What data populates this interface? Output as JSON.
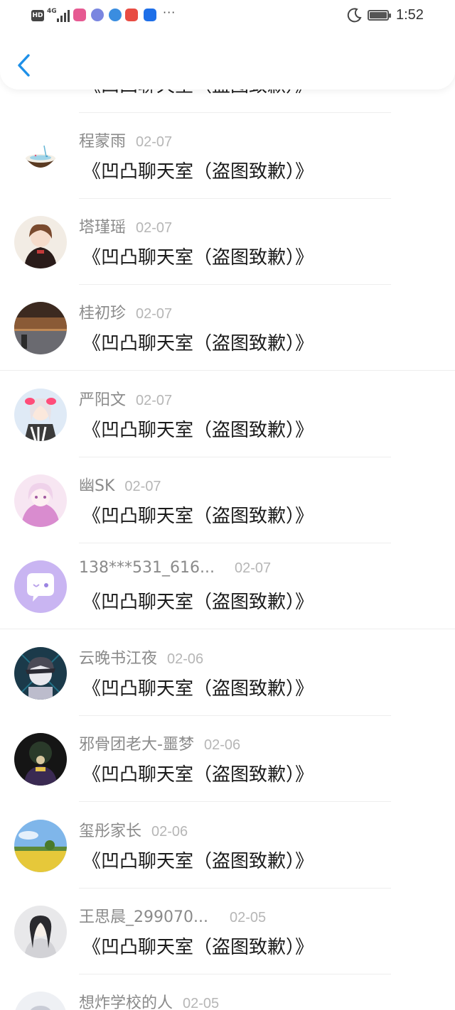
{
  "status_bar": {
    "hd": "HD",
    "network": "4G",
    "time": "1:52",
    "battery_level": 0.85,
    "more": "···"
  },
  "header": {
    "back_icon": "chevron-left-icon",
    "accent": "#1e90e8"
  },
  "partial_top_message": "《凹凸聊天室（盗图致歉）》",
  "comments": [
    {
      "name": "程蒙雨",
      "date": "02-07",
      "message": "《凹凸聊天室（盗图致歉）》"
    },
    {
      "name": "塔瑾瑶",
      "date": "02-07",
      "message": "《凹凸聊天室（盗图致歉）》"
    },
    {
      "name": "桂初珍",
      "date": "02-07",
      "message": "《凹凸聊天室（盗图致歉）》"
    },
    {
      "name": "严阳文",
      "date": "02-07",
      "message": "《凹凸聊天室（盗图致歉）》"
    },
    {
      "name": "幽SK",
      "date": "02-07",
      "message": "《凹凸聊天室（盗图致歉）》"
    },
    {
      "name": "138***531_616...",
      "date": "02-07",
      "message": "《凹凸聊天室（盗图致歉）》"
    },
    {
      "name": "云晚书江夜",
      "date": "02-06",
      "message": "《凹凸聊天室（盗图致歉）》"
    },
    {
      "name": "邪骨团老大-噩梦",
      "date": "02-06",
      "message": "《凹凸聊天室（盗图致歉）》"
    },
    {
      "name": "玺彤家长",
      "date": "02-06",
      "message": "《凹凸聊天室（盗图致歉）》"
    },
    {
      "name": "王思晨_299070...",
      "date": "02-05",
      "message": "《凹凸聊天室（盗图致歉）》"
    },
    {
      "name": "想炸学校的人",
      "date": "02-05",
      "message": ""
    }
  ]
}
